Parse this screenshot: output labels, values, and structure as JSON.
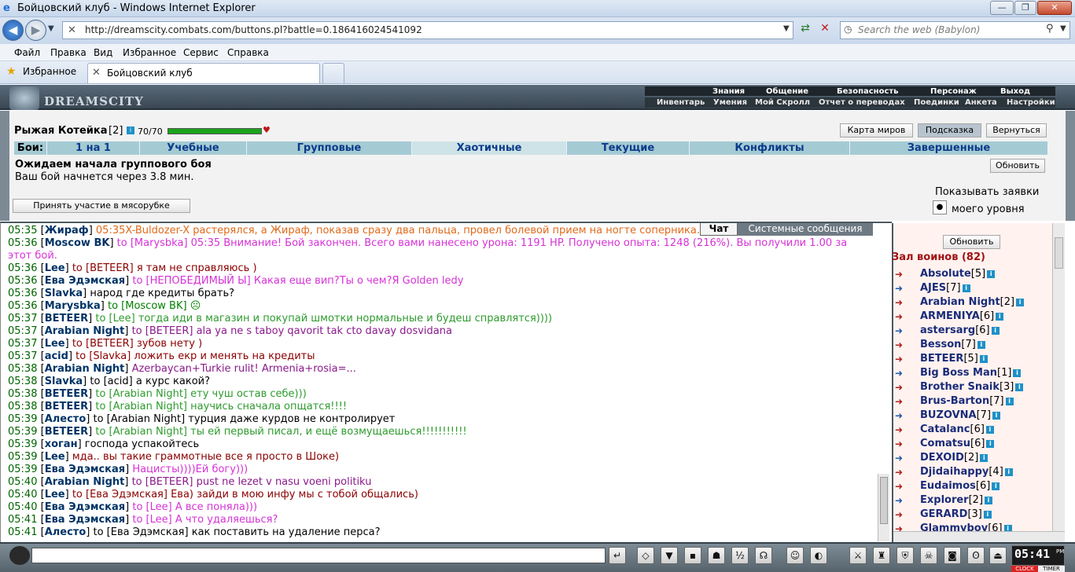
{
  "window": {
    "title": "Бойцовский клуб - Windows Internet Explorer",
    "minimize": "—",
    "maximize": "❐",
    "close": "✕"
  },
  "browser": {
    "url": "http://dreamscity.combats.com/buttons.pl?battle=0.186416024541092",
    "search_placeholder": "Search the web (Babylon)",
    "menu": [
      "Файл",
      "Правка",
      "Вид",
      "Избранное",
      "Сервис",
      "Справка"
    ],
    "favorites_label": "Избранное",
    "tab_title": "Бойцовский клуб"
  },
  "game": {
    "logo": "DREAMSCITY",
    "top_nav": [
      "Знания",
      "Общение",
      "Безопасность",
      "Персонаж",
      "Выход"
    ],
    "sub_nav": [
      "Инвентарь",
      "Умения",
      "Мой Скролл",
      "Отчет о переводах",
      "Поединки",
      "Анкета",
      "Настройки"
    ],
    "player": {
      "name": "Рыжая Котейка",
      "level": "[2]",
      "hp": "70/70",
      "hp_fraction": 1.0
    },
    "panel_buttons": [
      "Карта миров",
      "Подсказка",
      "Вернуться"
    ],
    "battle_label": "Бои:",
    "battle_tabs": [
      "1 на 1",
      "Учебные",
      "Групповые",
      "Хаотичные",
      "Текущие",
      "Конфликты",
      "Завершенные"
    ],
    "active_battle_tab": "Хаотичные",
    "status_title": "Ожидаем начала группового боя",
    "status_text": "Ваш бой начнется через 3.8 мин.",
    "refresh_button": "Обновить",
    "join_button": "Принять участие в мясорубке",
    "show_requests_label": "Показывать заявки",
    "show_requests_option": "моего уровня"
  },
  "chat": {
    "tabs": [
      "Чат",
      "Системные сообщения"
    ],
    "lines": [
      {
        "time": "05:35",
        "nick": "Жираф",
        "to": "",
        "text": "05:35X-Buldozer-X растерялся, а Жираф, показав сразу два пальца, провел болевой прием на ногте соперника.",
        "color": "#e06a1a"
      },
      {
        "time": "05:36",
        "nick": "Moscow BK",
        "to": "to [Marysbka]",
        "text": "05:35 Внимание! Бой закончен. Всего вами нанесено урона: 1191 HP. Получено опыта: 1248 (216%). Вы получили 1.00 за",
        "color": "#d632d6"
      },
      {
        "time": "",
        "nick": "",
        "to": "",
        "text": "этот бой.",
        "color": "#d632d6"
      },
      {
        "time": "05:36",
        "nick": "Lee",
        "to": "to [BETEER]",
        "text": "я там не справляюсь )",
        "color": "#8b0000"
      },
      {
        "time": "05:36",
        "nick": "Ева Эдэмская",
        "to": "to [НЕПОБЕДИМЫЙ Ы]",
        "text": "Какая еще вип?Ты о чем?Я Golden ledy",
        "color": "#d632d6"
      },
      {
        "time": "05:36",
        "nick": "Slavka",
        "to": "",
        "text": "народ где кредиты брать?",
        "color": "#000000"
      },
      {
        "time": "05:36",
        "nick": "Marysbka",
        "to": "to [Moscow BK]",
        "text": "☹",
        "color": "#008000"
      },
      {
        "time": "05:37",
        "nick": "BETEER",
        "to": "to [Lee]",
        "text": "тогда иди в магазин и покупай шмотки нормальные и будеш справлятся))))",
        "color": "#2e9b2e"
      },
      {
        "time": "05:37",
        "nick": "Arabian Night",
        "to": "to [BETEER]",
        "text": "ala ya ne s taboy qavorit tak cto davay dosvidana",
        "color": "#8b1a8b"
      },
      {
        "time": "05:37",
        "nick": "Lee",
        "to": "to [BETEER]",
        "text": "зубов нету )",
        "color": "#8b0000"
      },
      {
        "time": "05:37",
        "nick": "acid",
        "to": "to [Slavka]",
        "text": "ложить екр и менять на кредиты",
        "color": "#8b0000"
      },
      {
        "time": "05:38",
        "nick": "Arabian Night",
        "to": "",
        "text": "Azerbaycan+Turkie rulit! Armenia+rosia=...",
        "color": "#8b1a8b"
      },
      {
        "time": "05:38",
        "nick": "Slavka",
        "to": "to [acid]",
        "text": "а курс какой?",
        "color": "#000000"
      },
      {
        "time": "05:38",
        "nick": "BETEER",
        "to": "to [Arabian Night]",
        "text": "ету чуш остав себе)))",
        "color": "#2e9b2e"
      },
      {
        "time": "05:38",
        "nick": "BETEER",
        "to": "to [Arabian Night]",
        "text": "научись сначала опщатся!!!!",
        "color": "#2e9b2e"
      },
      {
        "time": "05:39",
        "nick": "Алесто",
        "to": "to [Arabian Night]",
        "text": "турция даже курдов не контролирует",
        "color": "#000000"
      },
      {
        "time": "05:39",
        "nick": "BETEER",
        "to": "to [Arabian Night]",
        "text": "ты ей первый писал, и ещё возмущаешься!!!!!!!!!!!",
        "color": "#2e9b2e"
      },
      {
        "time": "05:39",
        "nick": "хоган",
        "to": "",
        "text": "господа успакойтесь",
        "color": "#000000"
      },
      {
        "time": "05:39",
        "nick": "Lee",
        "to": "",
        "text": "мда.. вы такие граммотные все я просто в Шоке)",
        "color": "#8b0000"
      },
      {
        "time": "05:39",
        "nick": "Ева Эдэмская",
        "to": "",
        "text": "Нацисты))))Ей богу)))",
        "color": "#d632d6"
      },
      {
        "time": "05:40",
        "nick": "Arabian Night",
        "to": "to [BETEER]",
        "text": "pust ne lezet v nasu voeni politiku",
        "color": "#8b1a8b"
      },
      {
        "time": "05:40",
        "nick": "Lee",
        "to": "to [Ева Эдэмская]",
        "text": "Ева) зайди в мою инфу мы с тобой общались)",
        "color": "#8b0000"
      },
      {
        "time": "05:40",
        "nick": "Ева Эдэмская",
        "to": "to [Lee]",
        "text": "А все поняла)))",
        "color": "#d632d6"
      },
      {
        "time": "05:41",
        "nick": "Ева Эдэмская",
        "to": "to [Lee]",
        "text": "А что удаляешься?",
        "color": "#d632d6"
      },
      {
        "time": "05:41",
        "nick": "Алесто",
        "to": "to [Ева Эдэмская]",
        "text": "как поставить на удаление перса?",
        "color": "#000000"
      }
    ]
  },
  "roster": {
    "refresh": "Обновить",
    "title": "Зал воинов (82)",
    "players": [
      {
        "name": "Absolute",
        "lvl": "[5]"
      },
      {
        "name": "AJES",
        "lvl": "[7]"
      },
      {
        "name": "Arabian Night",
        "lvl": "[2]"
      },
      {
        "name": "ARMENIYA",
        "lvl": "[6]"
      },
      {
        "name": "astersarg",
        "lvl": "[6]"
      },
      {
        "name": "Besson",
        "lvl": "[7]"
      },
      {
        "name": "BETEER",
        "lvl": "[5]"
      },
      {
        "name": "Big Boss Man",
        "lvl": "[1]"
      },
      {
        "name": "Brother Snaik",
        "lvl": "[3]"
      },
      {
        "name": "Brus-Barton",
        "lvl": "[7]"
      },
      {
        "name": "BUZOVNA",
        "lvl": "[7]"
      },
      {
        "name": "Catalanc",
        "lvl": "[6]"
      },
      {
        "name": "Comatsu",
        "lvl": "[6]"
      },
      {
        "name": "DEXOID",
        "lvl": "[2]"
      },
      {
        "name": "Djidaihappy",
        "lvl": "[4]"
      },
      {
        "name": "Eudaimos",
        "lvl": "[6]"
      },
      {
        "name": "Explorer",
        "lvl": "[2]"
      },
      {
        "name": "GERARD",
        "lvl": "[3]"
      },
      {
        "name": "Glammyboy",
        "lvl": "[6]"
      }
    ]
  },
  "clock": {
    "time": "05:41",
    "am_pm": "PM",
    "labels": [
      "CLOCK",
      "TIMER"
    ]
  },
  "colors": {
    "accent": "#0c3b8a",
    "hp": "#1aa31a",
    "tabbar": "#a4cbd4"
  }
}
